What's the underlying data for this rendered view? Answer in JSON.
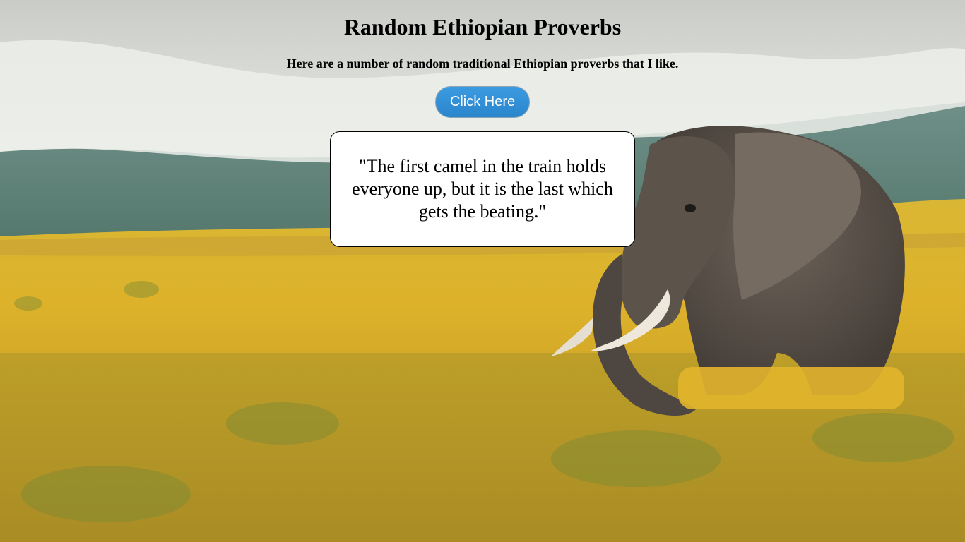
{
  "page": {
    "title": "Random Ethiopian Proverbs",
    "subtitle": "Here are a number of random traditional Ethiopian proverbs that I like.",
    "button_label": "Click Here",
    "quote": "\"The first camel in the train holds everyone up, but it is the last which gets the beating.\""
  },
  "background": {
    "description_icon": "elephant-in-flower-field-image",
    "colors": {
      "sky": "#e6e8e4",
      "hills": "#5f8279",
      "field": "#d8ae2a",
      "elephant": "#5e554d",
      "tusk": "#efe9dc"
    }
  },
  "colors": {
    "button": "#2e8bd3",
    "button_text": "#ffffff",
    "quote_box": "#ffffff"
  }
}
